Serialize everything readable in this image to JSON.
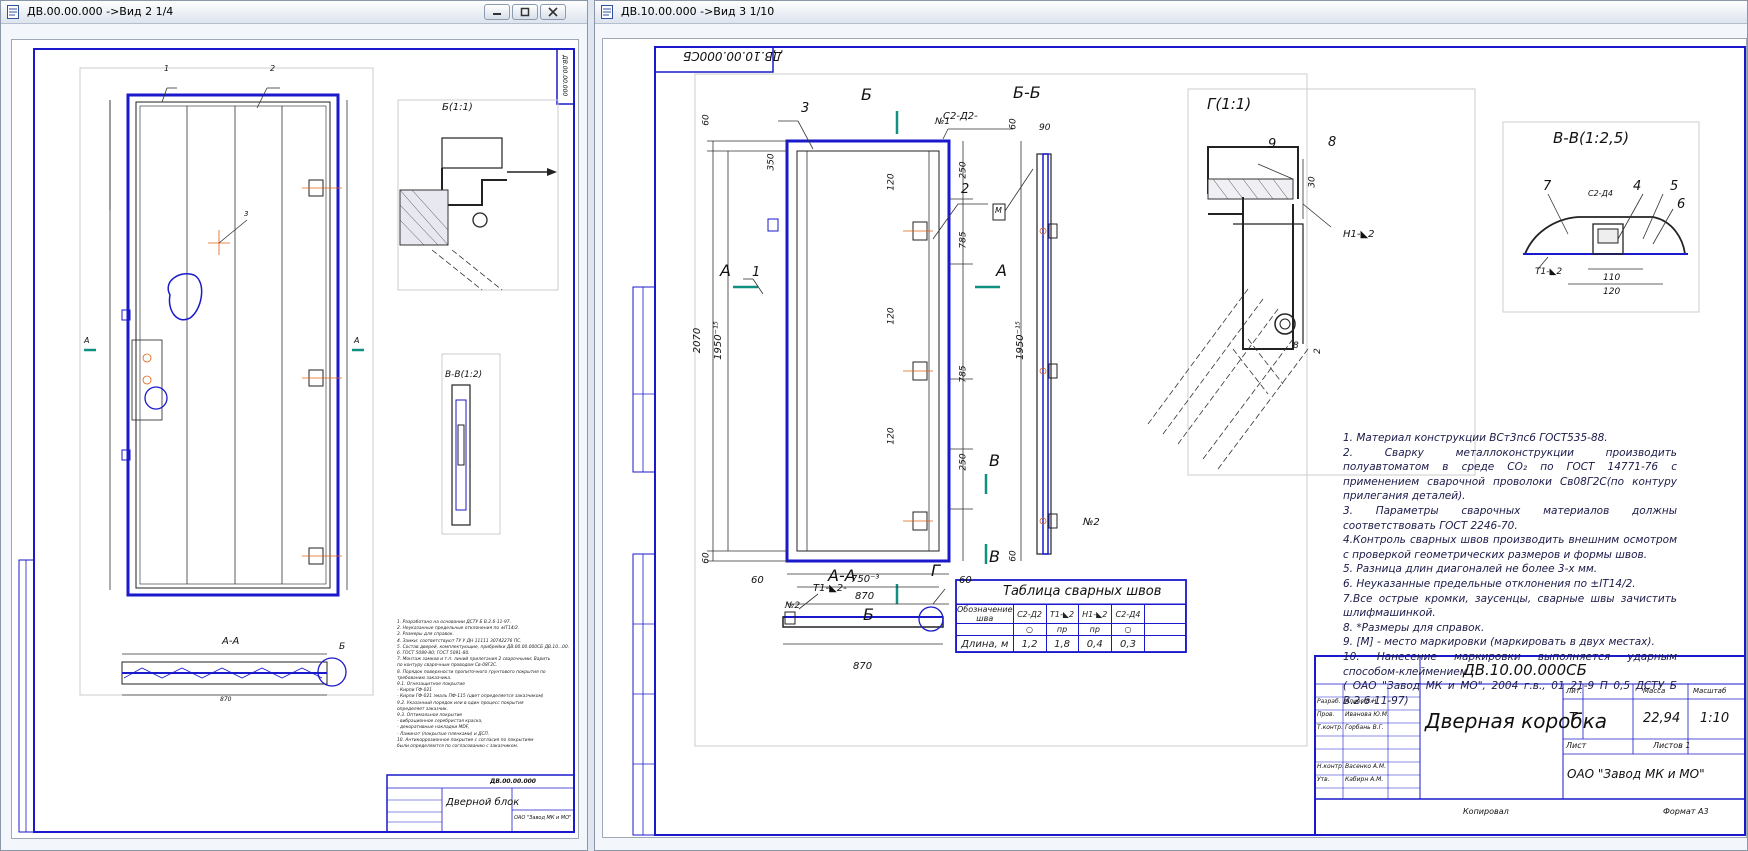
{
  "window_left": {
    "title": "ДВ.00.00.000 ->Вид 2  1/4",
    "sheet_code_rot": "ДВ.00.00.000",
    "labels": {
      "pos1": "1",
      "pos2": "2",
      "pos3": "3",
      "secA1": "А",
      "secA2": "А",
      "secB": "Б",
      "view_b1": "Б(1:1)",
      "view_vv": "В-В(1:2)",
      "aa": "А-А",
      "dim870": "870",
      "b_mark": "Б"
    },
    "notes": [
      "1. Разработано на основании ДСТУ Б В.2.6-11-97.",
      "2. Неуказанные предельные отклонения по ±IT14/2.",
      "3. Размеры для справок.",
      "4. Замки: соответствуют ТУ У ДН 11111 30742276 ПС.",
      "5. Состав дверей, комплектующие, прибрейки ДВ.00.00.000СБ ДВ.10...00.",
      "6. ГОСТ 5089-80; ГОСТ 5091-80.",
      "7. Монтаж замков и т.п. линий прилегания 2 сварочными; Варить",
      "по контуру сварочным проводом Св-08Г2С.",
      "8. Порядок поверхности пропиточного грунтового покрытия по",
      "требованию заказчика.",
      "9.1. Огнезащитное покрытие",
      "- Кирпи ГФ-021",
      "- Кирпи ГФ-021 эмаль ПФ-115 (цвет определяется заказчиком)",
      "9.2. Указанный порядок или в один процесс покрытия",
      "определяет заказчик.",
      "9.3. Оптимальное покрытие",
      "- вибрационное серебристая краска,",
      "- декоративные накладки MDF,",
      "- Ламинат (покрытые пленками) и ДСП.",
      "10. Антикоррозионное покрытие с согласия по покрытиям",
      "были определяются по согласованию с заказчиком."
    ],
    "title_block": {
      "code": "ДВ.00.00.000",
      "name": "Дверной блок",
      "org": "ОАО \"Завод МК и МО\""
    }
  },
  "window_right": {
    "title": "ДВ.10.00.000 ->Вид 3  1/10",
    "sheet_code_rot": "ДВ.10.00.000СБ",
    "views": {
      "bb": "Б-Б",
      "g": "Г(1:1)",
      "vv": "В-В(1:2,5)",
      "aa": "А-А",
      "b_top": "Б",
      "b_bottom": "Б",
      "a_left": "А",
      "a_right": "А",
      "v_top": "В",
      "v_bottom": "В",
      "g_mark": "Г",
      "m1": "№1",
      "m2": "№2",
      "m2b": "№2"
    },
    "positions": {
      "p1": "1",
      "p2": "2",
      "p3": "3",
      "p4": "4",
      "p5": "5",
      "p6": "6",
      "p7": "7",
      "p8": "8",
      "p9": "9"
    },
    "weld_marks": {
      "c2": "С2-Д2-",
      "c2b": "С2-Д4",
      "t1": "Т1-◣2",
      "h1": "Н1-◣2",
      "t1b": "Т1-◣2-"
    },
    "dims": {
      "d60a": "60",
      "d350": "350",
      "d250a": "250",
      "d120a": "120",
      "d785a": "785",
      "d120b": "120",
      "d785b": "785",
      "d120c": "120",
      "d250b": "250",
      "d60b": "60",
      "d2070": "2070",
      "d1950": "1950⁻¹⁵",
      "d60c": "60",
      "d750": "750⁻³",
      "d60d": "60",
      "d870": "870",
      "d90": "90",
      "d60e": "60",
      "d1950b": "1950⁻¹⁵",
      "d60f": "60",
      "d30": "30",
      "d8": "8",
      "d2": "2",
      "d110": "110",
      "d120": "120",
      "d870b": "870",
      "m_box": "М"
    },
    "notes": [
      "1. Материал конструкции ВСт3пс6 ГОСТ535-88.",
      "2. Сварку металлоконструкции производить полуавтоматом в среде CO₂ по ГОСТ 14771-76 с применением сварочной проволоки Св08Г2С(по контуру прилегания деталей).",
      "3. Параметры сварочных материалов должны соответствовать ГОСТ 2246-70.",
      "4.Контроль сварных швов производить внешним осмотром с проверкой геометрических размеров и формы швов.",
      "5. Разница длин диагоналей не более 3-х мм.",
      "6. Неуказанные предельные отклонения по ±IT14/2.",
      "7.Все острые кромки, заусенцы, сварные швы зачистить шлифмашинкой.",
      "8. *Размеры для справок.",
      "9. [М] - место маркировки (маркировать в двух местах).",
      "10. Нанесение маркировки выполняется ударным способом-клеймением :",
      "( ОАО \"Завод МК и МО\", 2004 г.в., 01 21-9 П 0,5 ДСТУ Б В.2.6-11-97)"
    ],
    "weld_table": {
      "title": "Таблица сварных швов",
      "head": [
        "Обозначение шва",
        "С2-Д2",
        "Т1-◣2",
        "Н1-◣2",
        "С2-Д4"
      ],
      "head2": [
        "",
        "○",
        "пр",
        "пр",
        "○"
      ],
      "row_label": "Длина, м",
      "values": [
        "1,2",
        "1,8",
        "0,4",
        "0,3"
      ]
    },
    "title_block": {
      "code": "ДВ.10.00.000СБ",
      "name": "Дверная коробка",
      "lit": "Т",
      "mass": "22,94",
      "scale": "1:10",
      "sheet": "Лист",
      "sheets": "Листов 1",
      "org": "ОАО \"Завод МК и МО\"",
      "copied": "Копировал",
      "format": "Формат А3",
      "hdr": [
        "Лит.",
        "Масса",
        "Масштаб"
      ],
      "people": [
        "Разраб.",
        "Пров.",
        "Т.контр.",
        "",
        "Н.контр.",
        "Утв."
      ],
      "names": [
        "Алиев В.Н.",
        "Иванова Ю.М.",
        "Горбань В.Г.",
        "",
        "Васенко А.М.",
        "Кабирн А.М."
      ]
    }
  },
  "colors": {
    "frame": "#1a1acc",
    "accent": "#e06010",
    "marker": "#109080"
  }
}
